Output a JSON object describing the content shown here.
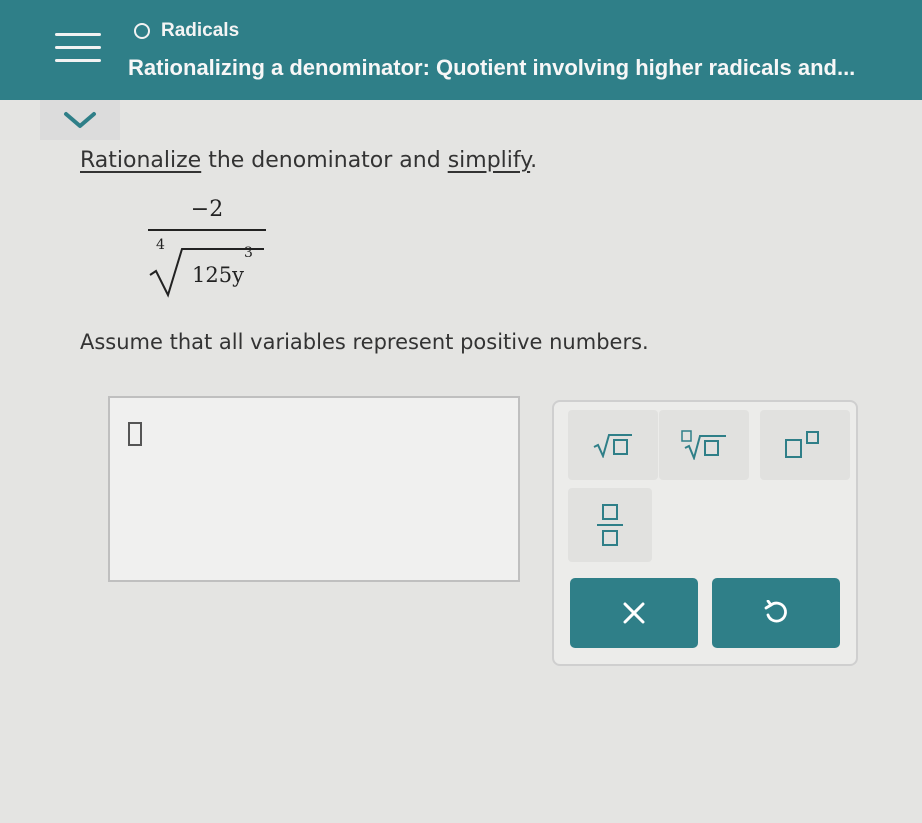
{
  "header": {
    "topic": "Radicals",
    "title": "Rationalizing a denominator: Quotient involving higher radicals and..."
  },
  "problem": {
    "instruction_parts": [
      "Rationalize",
      " the denominator and ",
      "simplify",
      "."
    ],
    "numerator": "−2",
    "root_index": "4",
    "radicand_base": "125y",
    "radicand_exponent": "3",
    "assumption": "Assume that all variables represent positive numbers."
  },
  "keypad": {
    "keys": [
      "square-root",
      "nth-root",
      "exponent",
      "fraction"
    ],
    "buttons": [
      "clear",
      "undo"
    ]
  },
  "colors": {
    "accent": "#2f7f88",
    "background": "#e4e4e2"
  }
}
